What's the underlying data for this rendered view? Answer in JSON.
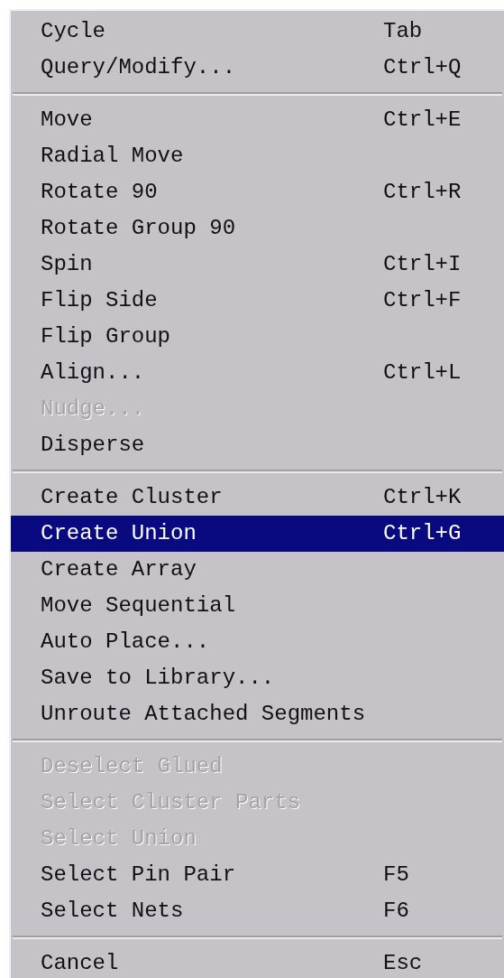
{
  "menu": {
    "groups": [
      {
        "items": [
          {
            "label": "Cycle",
            "shortcut": "Tab",
            "disabled": false,
            "selected": false
          },
          {
            "label": "Query/Modify...",
            "shortcut": "Ctrl+Q",
            "disabled": false,
            "selected": false
          }
        ]
      },
      {
        "items": [
          {
            "label": "Move",
            "shortcut": "Ctrl+E",
            "disabled": false,
            "selected": false
          },
          {
            "label": "Radial Move",
            "disabled": false,
            "selected": false
          },
          {
            "label": "Rotate 90",
            "shortcut": "Ctrl+R",
            "disabled": false,
            "selected": false
          },
          {
            "label": "Rotate Group 90",
            "disabled": false,
            "selected": false
          },
          {
            "label": "Spin",
            "shortcut": "Ctrl+I",
            "disabled": false,
            "selected": false
          },
          {
            "label": "Flip Side",
            "shortcut": "Ctrl+F",
            "disabled": false,
            "selected": false
          },
          {
            "label": "Flip Group",
            "disabled": false,
            "selected": false
          },
          {
            "label": "Align...",
            "shortcut": "Ctrl+L",
            "disabled": false,
            "selected": false
          },
          {
            "label": "Nudge...",
            "disabled": true,
            "selected": false
          },
          {
            "label": "Disperse",
            "disabled": false,
            "selected": false
          }
        ]
      },
      {
        "items": [
          {
            "label": "Create Cluster",
            "shortcut": "Ctrl+K",
            "disabled": false,
            "selected": false
          },
          {
            "label": "Create Union",
            "shortcut": "Ctrl+G",
            "disabled": false,
            "selected": true
          },
          {
            "label": "Create Array",
            "disabled": false,
            "selected": false
          },
          {
            "label": "Move Sequential",
            "disabled": false,
            "selected": false
          },
          {
            "label": "Auto Place...",
            "disabled": false,
            "selected": false
          },
          {
            "label": "Save to Library...",
            "disabled": false,
            "selected": false
          },
          {
            "label": "Unroute Attached Segments",
            "disabled": false,
            "selected": false
          }
        ]
      },
      {
        "items": [
          {
            "label": "Deselect Glued",
            "disabled": true,
            "selected": false
          },
          {
            "label": "Select Cluster Parts",
            "disabled": true,
            "selected": false
          },
          {
            "label": "Select Union",
            "disabled": true,
            "selected": false
          },
          {
            "label": "Select Pin Pair",
            "shortcut": "F5",
            "disabled": false,
            "selected": false
          },
          {
            "label": "Select Nets",
            "shortcut": "F6",
            "disabled": false,
            "selected": false
          }
        ]
      },
      {
        "items": [
          {
            "label": "Cancel",
            "shortcut": "Esc",
            "disabled": false,
            "selected": false
          }
        ]
      }
    ]
  }
}
